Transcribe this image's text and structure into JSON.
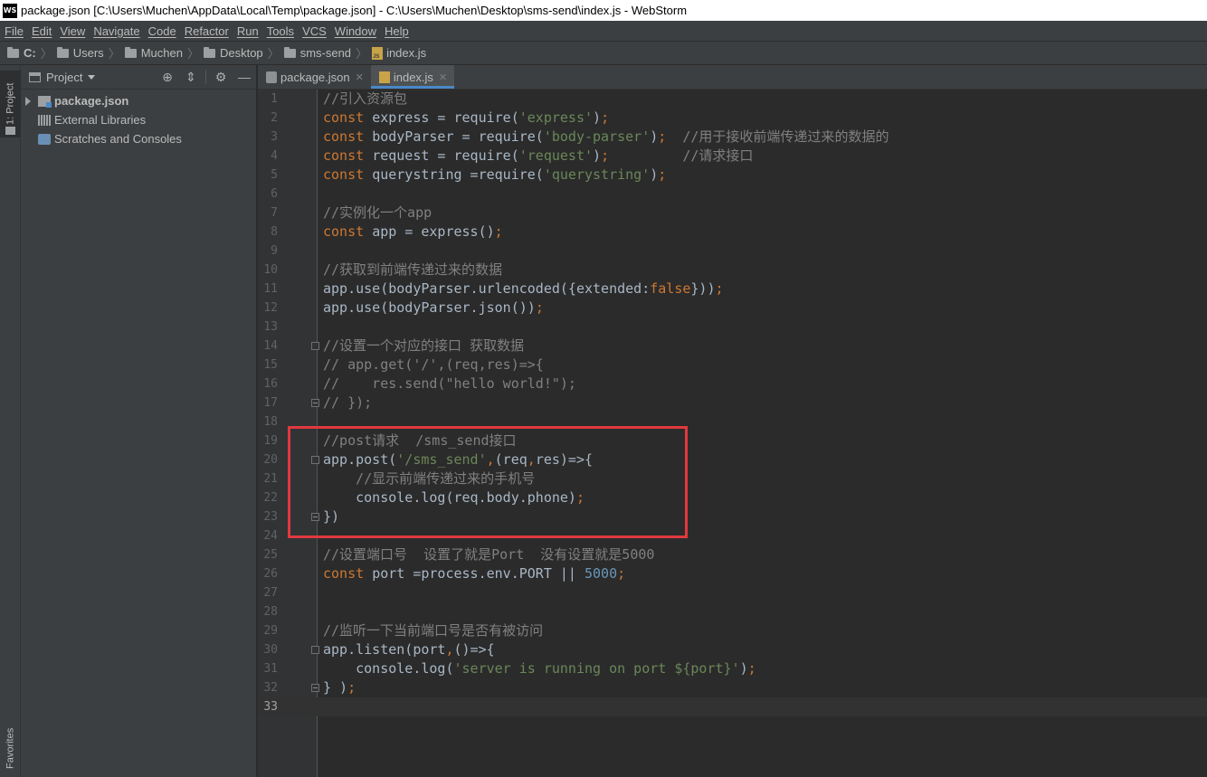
{
  "window": {
    "title": "package.json [C:\\Users\\Muchen\\AppData\\Local\\Temp\\package.json] - C:\\Users\\Muchen\\Desktop\\sms-send\\index.js - WebStorm",
    "logo_text": "WS"
  },
  "menu": [
    "File",
    "Edit",
    "View",
    "Navigate",
    "Code",
    "Refactor",
    "Run",
    "Tools",
    "VCS",
    "Window",
    "Help"
  ],
  "breadcrumb": [
    "C:",
    "Users",
    "Muchen",
    "Desktop",
    "sms-send",
    "index.js"
  ],
  "left_stripe": {
    "project_tab": "1: Project",
    "favorites_tab": "Favorites"
  },
  "project_panel": {
    "title": "Project",
    "tree": [
      {
        "label": "package.json",
        "icon": "folder-icon",
        "expandable": true
      },
      {
        "label": "External Libraries",
        "icon": "libraries-icon",
        "expandable": false
      },
      {
        "label": "Scratches and Consoles",
        "icon": "scratches-icon",
        "expandable": false
      }
    ]
  },
  "tabs": [
    {
      "label": "package.json",
      "icon": "json-file-icon",
      "active": false
    },
    {
      "label": "index.js",
      "icon": "js-file-icon",
      "active": true
    }
  ],
  "editor": {
    "current_line": 33,
    "lines": [
      [
        [
          "cm",
          "//引入资源包"
        ]
      ],
      [
        [
          "kw",
          "const "
        ],
        [
          "t",
          "express = require("
        ],
        [
          "str",
          "'express'"
        ],
        [
          "t",
          ")"
        ],
        [
          "kw",
          ";"
        ]
      ],
      [
        [
          "kw",
          "const "
        ],
        [
          "t",
          "bodyParser = require("
        ],
        [
          "str",
          "'body-parser'"
        ],
        [
          "t",
          ")"
        ],
        [
          "kw",
          ";"
        ],
        [
          "t",
          "  "
        ],
        [
          "cm",
          "//用于接收前端传递过来的数据的"
        ]
      ],
      [
        [
          "kw",
          "const "
        ],
        [
          "t",
          "request = require("
        ],
        [
          "str",
          "'request'"
        ],
        [
          "t",
          ")"
        ],
        [
          "kw",
          ";"
        ],
        [
          "t",
          "         "
        ],
        [
          "cm",
          "//请求接口"
        ]
      ],
      [
        [
          "kw",
          "const "
        ],
        [
          "t",
          "querystring =require("
        ],
        [
          "str",
          "'querystring'"
        ],
        [
          "t",
          ")"
        ],
        [
          "kw",
          ";"
        ]
      ],
      [],
      [
        [
          "cm",
          "//实例化一个app"
        ]
      ],
      [
        [
          "kw",
          "const "
        ],
        [
          "t",
          "app = express()"
        ],
        [
          "kw",
          ";"
        ]
      ],
      [],
      [
        [
          "cm",
          "//获取到前端传递过来的数据"
        ]
      ],
      [
        [
          "t",
          "app.use(bodyParser.urlencoded({extended:"
        ],
        [
          "kw",
          "false"
        ],
        [
          "t",
          "}))"
        ],
        [
          "kw",
          ";"
        ]
      ],
      [
        [
          "t",
          "app.use(bodyParser.json())"
        ],
        [
          "kw",
          ";"
        ]
      ],
      [],
      [
        [
          "cm",
          "//设置一个对应的接口 获取数据"
        ]
      ],
      [
        [
          "cm",
          "// app.get('/',(req,res)=>{"
        ]
      ],
      [
        [
          "cm",
          "//    res.send(\"hello world!\");"
        ]
      ],
      [
        [
          "cm",
          "// });"
        ]
      ],
      [],
      [
        [
          "cm",
          "//post请求  /sms_send接口"
        ]
      ],
      [
        [
          "t",
          "app.post("
        ],
        [
          "str",
          "'/sms_send'"
        ],
        [
          "kw",
          ","
        ],
        [
          "t",
          "(req"
        ],
        [
          "kw",
          ","
        ],
        [
          "t",
          "res)=>{"
        ]
      ],
      [
        [
          "t",
          "    "
        ],
        [
          "cm",
          "//显示前端传递过来的手机号"
        ]
      ],
      [
        [
          "t",
          "    console.log(req.body.phone)"
        ],
        [
          "kw",
          ";"
        ]
      ],
      [
        [
          "t",
          "})"
        ]
      ],
      [],
      [
        [
          "cm",
          "//设置端口号  设置了就是Port  没有设置就是5000"
        ]
      ],
      [
        [
          "kw",
          "const "
        ],
        [
          "t",
          "port =process.env.PORT || "
        ],
        [
          "num",
          "5000"
        ],
        [
          "kw",
          ";"
        ]
      ],
      [],
      [],
      [
        [
          "cm",
          "//监听一下当前端口号是否有被访问"
        ]
      ],
      [
        [
          "t",
          "app.listen(port"
        ],
        [
          "kw",
          ","
        ],
        [
          "t",
          "()=>{"
        ]
      ],
      [
        [
          "t",
          "    console.log("
        ],
        [
          "str",
          "'server is running on port ${port}'"
        ],
        [
          "t",
          ")"
        ],
        [
          "kw",
          ";"
        ]
      ],
      [
        [
          "t",
          "} )"
        ],
        [
          "kw",
          ";"
        ]
      ],
      []
    ],
    "fold_markers": [
      {
        "line": 14,
        "kind": "start"
      },
      {
        "line": 17,
        "kind": "end"
      },
      {
        "line": 20,
        "kind": "start"
      },
      {
        "line": 23,
        "kind": "end"
      },
      {
        "line": 30,
        "kind": "start"
      },
      {
        "line": 32,
        "kind": "end"
      }
    ]
  },
  "annotation": {
    "color": "#e0393e"
  }
}
